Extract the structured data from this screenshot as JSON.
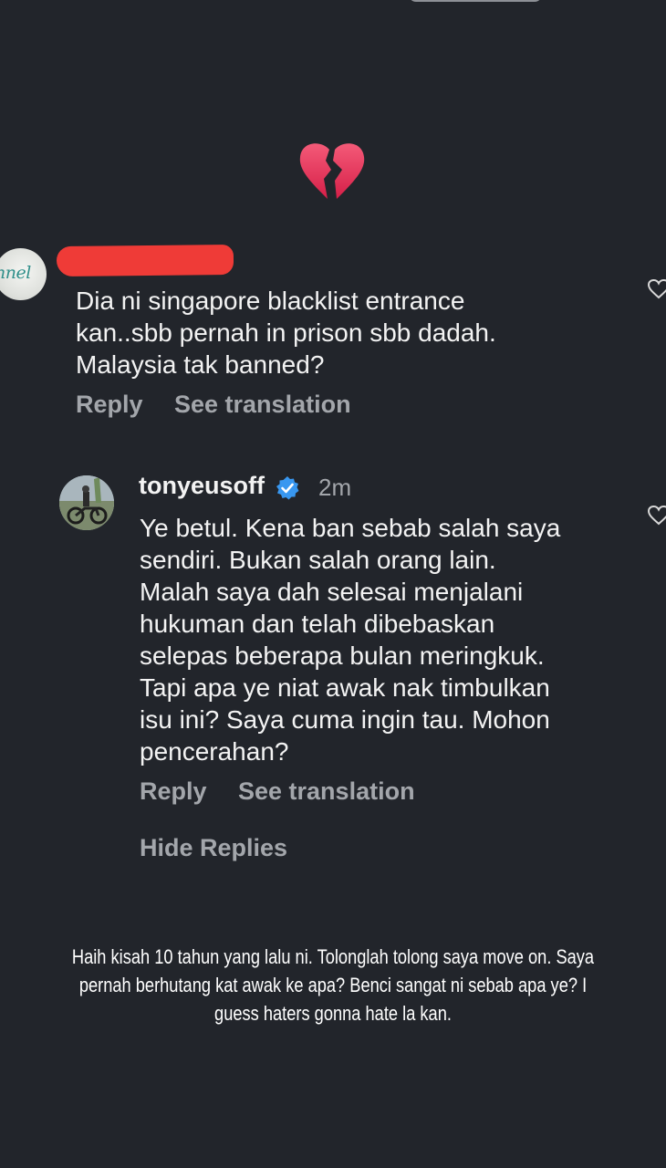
{
  "comment_1": {
    "avatar_text": "nnel",
    "text": "Dia ni singapore blacklist entrance\nkan..sbb pernah in prison sbb dadah.\nMalaysia tak banned?",
    "reply_label": "Reply",
    "translate_label": "See translation"
  },
  "reply_1": {
    "username": "tonyeusoff",
    "time": "2m",
    "text": "Ye betul. Kena ban sebab salah saya\nsendiri. Bukan salah orang lain.\nMalah saya dah selesai menjalani\nhukuman dan telah dibebaskan\nselepas beberapa bulan meringkuk.\nTapi apa ye niat awak nak timbulkan\nisu ini? Saya cuma ingin tau. Mohon\npencerahan?",
    "reply_label": "Reply",
    "translate_label": "See translation",
    "hide_replies_label": "Hide Replies"
  },
  "caption": {
    "text": "Haih kisah 10 tahun yang lalu ni. Tolonglah tolong saya move on. Saya pernah berhutang kat awak ke apa? Benci sangat ni sebab apa ye? I guess haters gonna hate la kan."
  },
  "colors": {
    "background": "#22252b",
    "muted_text": "#a3a6ab",
    "verified_badge": "#3897f0",
    "heart": "#e8335a",
    "redaction": "#ef3b37"
  },
  "icons": {
    "sticker": "broken-heart-icon",
    "like": "heart-outline-icon",
    "verified": "verified-badge-icon"
  }
}
